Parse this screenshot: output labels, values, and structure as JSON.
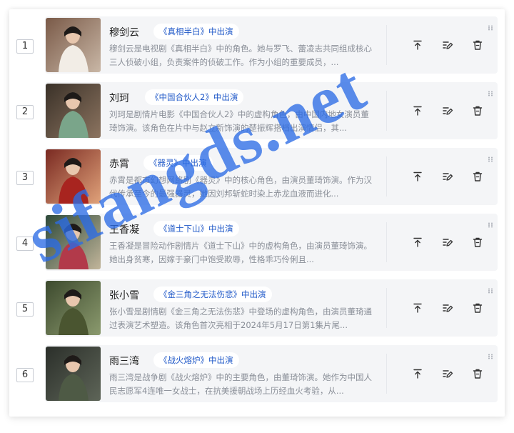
{
  "rows": [
    {
      "index": "1",
      "name": "穆剑云",
      "tag": "《真相半白》中出演",
      "desc": "穆剑云是电视剧《真相半白》中的角色。她与罗飞、蕾凌志共同组成核心三人侦破小组，负责案件的侦破工作。作为小组的重要成员，...",
      "thumb": {
        "bg1": "#7a5a48",
        "bg2": "#c9b7a6",
        "fig": "#f2ede6"
      }
    },
    {
      "index": "2",
      "name": "刘珂",
      "tag": "《中国合伙人2》中出演",
      "desc": "刘珂是剧情片电影《中国合伙人2》中的虚构角色，由中国内地女演员董琦饰演。该角色在片中与赵立新饰演的楚振辉搭档出演情侣，其...",
      "thumb": {
        "bg1": "#3a3128",
        "bg2": "#8c7460",
        "fig": "#7aa58a"
      }
    },
    {
      "index": "3",
      "name": "赤霄",
      "tag": "《器灵》中出演",
      "desc": "赤霄是都市幻想网络剧《器灵》中的核心角色，由演员董琦饰演。作为汉代传承至今的最强器灵，她因刘邦斩蛇时染上赤龙血液而进化...",
      "thumb": {
        "bg1": "#7a2a22",
        "bg2": "#e0a27a",
        "fig": "#a8241f"
      }
    },
    {
      "index": "4",
      "name": "王香凝",
      "tag": "《道士下山》中出演",
      "desc": "王香凝是冒险动作剧情片《道士下山》中的虚构角色，由演员董琦饰演。她出身贫寒，因嫁于豪门中饱受欺辱，性格乖巧伶俐且...",
      "thumb": {
        "bg1": "#2e4a3a",
        "bg2": "#c2b59a",
        "fig": "#b23a4a"
      }
    },
    {
      "index": "5",
      "name": "张小雪",
      "tag": "《金三角之无法伤悲》中出演",
      "desc": "张小雪是剧情剧《金三角之无法伤悲》中登场的虚构角色，由演员董琦通过表演艺术塑造。该角色首次亮相于2024年5月17日第1集片尾...",
      "thumb": {
        "bg1": "#3d4a2e",
        "bg2": "#8b9a6e",
        "fig": "#4a5530"
      }
    },
    {
      "index": "6",
      "name": "雨三湾",
      "tag": "《战火熔炉》中出演",
      "desc": "雨三湾是战争剧《战火熔炉》中的主要角色，由董琦饰演。她作为中国人民志愿军4连唯一女战士，在抗美援朝战场上历经血火考验，从...",
      "thumb": {
        "bg1": "#2b2f2a",
        "bg2": "#5e6558",
        "fig": "#4e5a45"
      }
    }
  ],
  "icons": {
    "top": "move-to-top-icon",
    "edit": "edit-icon",
    "delete": "delete-icon",
    "drag": "drag-handle-icon"
  },
  "watermark": "sifangds.net"
}
